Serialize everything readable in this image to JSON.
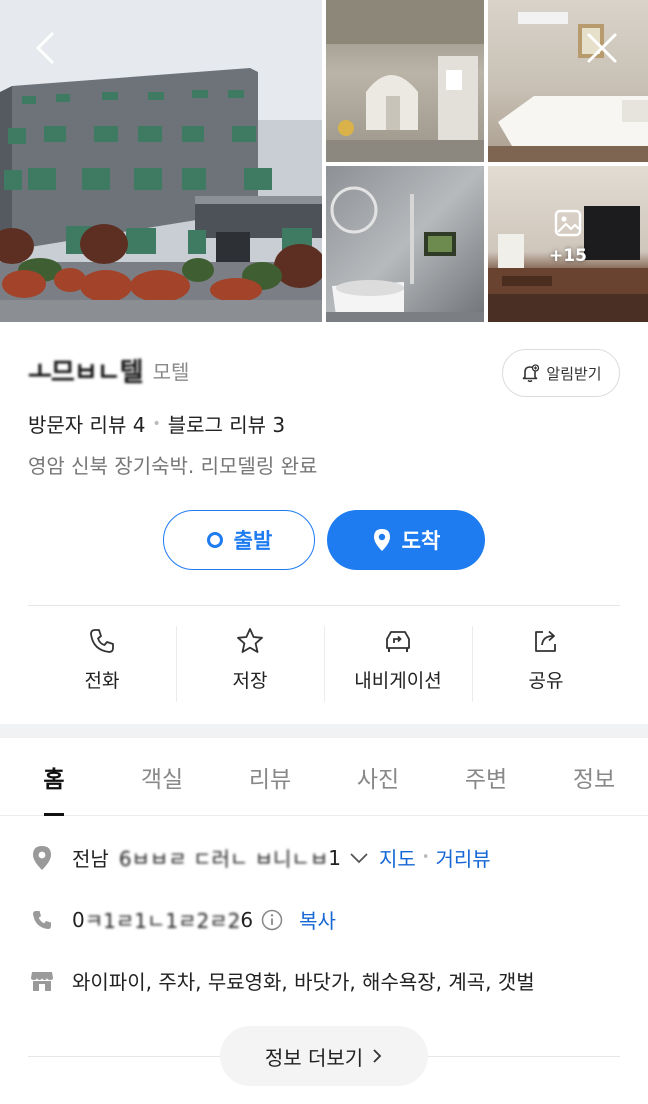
{
  "gallery": {
    "more_photos_count": "+15",
    "photos": [
      "building-exterior-photo",
      "hallway-photo",
      "bedroom-photo",
      "bathroom-photo",
      "room-tv-photo"
    ]
  },
  "place": {
    "name": "ㅗ므ㅂㄴ텔",
    "category": "모텔",
    "alert_label": "알림받기",
    "visitor_reviews": "방문자 리뷰 4",
    "blog_reviews": "블로그 리뷰 3",
    "description": "영암 신북 장기숙박. 리모델링 완료"
  },
  "route": {
    "depart_label": "출발",
    "arrive_label": "도착"
  },
  "actions": [
    {
      "label": "전화",
      "icon": "phone-icon"
    },
    {
      "label": "저장",
      "icon": "star-icon"
    },
    {
      "label": "내비게이션",
      "icon": "navigation-icon"
    },
    {
      "label": "공유",
      "icon": "share-icon"
    }
  ],
  "tabs": [
    "홈",
    "객실",
    "리뷰",
    "사진",
    "주변",
    "정보"
  ],
  "details": {
    "address_prefix": "전남",
    "address_blurred": "6ㅂㅂㄹ ㄷ러ㄴ ㅂ니ㄴㅂ",
    "address_suffix": "1",
    "map_link": "지도",
    "street_view_link": "거리뷰",
    "phone_prefix": "0",
    "phone_blurred": "ㅋ1ㄹ1ㄴ1ㄹ2ㄹ2",
    "phone_suffix": "6",
    "copy_label": "복사",
    "amenities": "와이파이, 주차, 무료영화, 바닷가, 해수욕장, 계곡, 갯벌",
    "more_info_label": "정보 더보기"
  },
  "colors": {
    "accent": "#1e7cf0",
    "link": "#1566d6",
    "muted_text": "#777777",
    "divider": "#f1f2f4"
  }
}
